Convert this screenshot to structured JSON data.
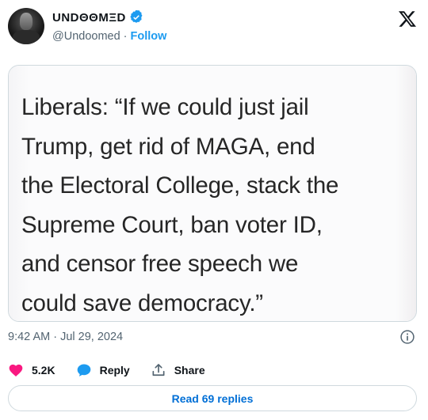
{
  "author": {
    "display_name": "UNDΘΘMΞD",
    "handle": "@Undoomed",
    "separator": "·",
    "follow_label": "Follow"
  },
  "media": {
    "text": "Liberals: “If we could just jail\nTrump, get rid of MAGA, end\nthe Electoral College, stack the\nSupreme Court, ban voter ID,\nand censor free speech we\ncould save democracy.”"
  },
  "meta": {
    "timestamp": "9:42 AM · Jul 29, 2024"
  },
  "actions": {
    "likes_count": "5.2K",
    "reply_label": "Reply",
    "share_label": "Share"
  },
  "replies": {
    "label": "Read 69 replies"
  },
  "colors": {
    "accent": "#1d9bf0",
    "like": "#f91880",
    "muted": "#536471",
    "link": "#006fd6"
  },
  "icons": [
    "verified-badge-icon",
    "x-logo-icon",
    "info-icon",
    "heart-icon",
    "reply-bubble-icon",
    "share-icon"
  ]
}
